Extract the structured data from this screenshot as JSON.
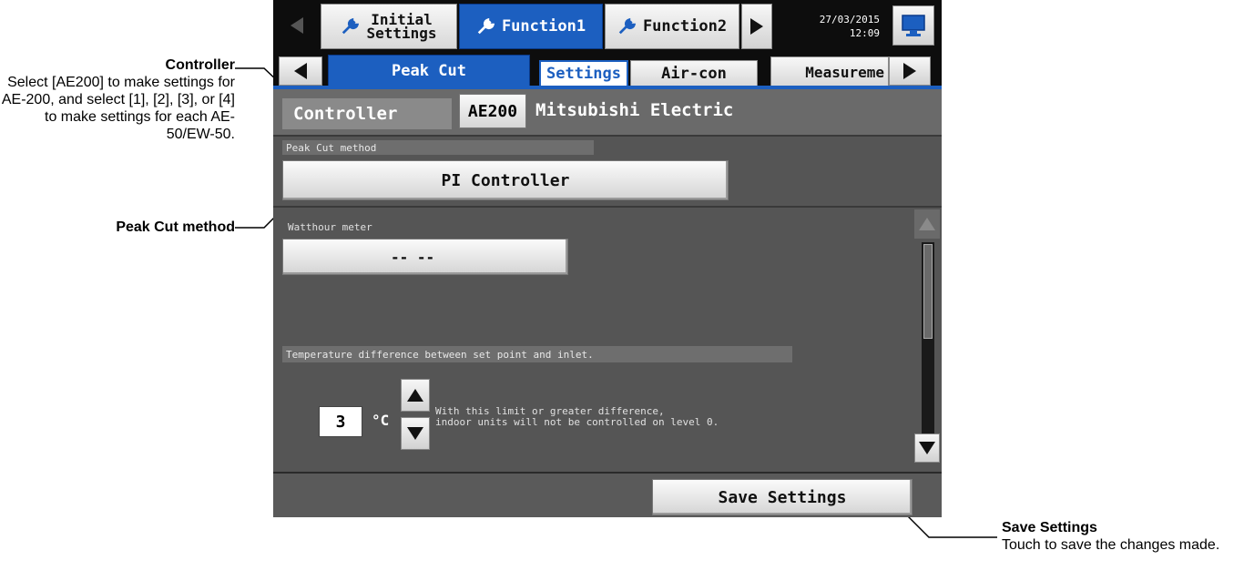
{
  "annotations": {
    "controller": {
      "title": "Controller",
      "body": "Select [AE200] to make settings for AE-200, and select [1], [2], [3], or [4] to make settings for each AE-50/EW-50."
    },
    "peak_cut": {
      "title": "Peak Cut method"
    },
    "save": {
      "title": "Save Settings",
      "body": "Touch to save the changes made."
    }
  },
  "top_tabs": [
    {
      "label": "Initial\nSettings",
      "icon": "wrench-icon",
      "active": false
    },
    {
      "label": "Function1",
      "icon": "wrench-icon",
      "active": true
    },
    {
      "label": "Function2",
      "icon": "wrench-icon",
      "active": false
    }
  ],
  "datetime": {
    "date": "27/03/2015",
    "time": "12:09"
  },
  "sub_tabs": {
    "peak_cut": "Peak Cut",
    "settings": "Settings",
    "aircon": "Air-con",
    "measurement": "Measureme"
  },
  "controller": {
    "label": "Controller",
    "button": "AE200",
    "name": "Mitsubishi Electric"
  },
  "peak_cut_method": {
    "header": "Peak Cut method",
    "value": "PI Controller"
  },
  "watthour": {
    "label": "Watthour meter",
    "value": "-- --"
  },
  "temp_diff": {
    "header": "Temperature difference between set point and inlet.",
    "value": "3",
    "unit": "°C",
    "note": "With this limit or greater difference,\nindoor units will not be controlled on level 0."
  },
  "save_button": "Save Settings",
  "colors": {
    "active_tab": "#1c5fc0",
    "screen_bg": "#555555",
    "tab_bar": "#0d0d0d"
  }
}
